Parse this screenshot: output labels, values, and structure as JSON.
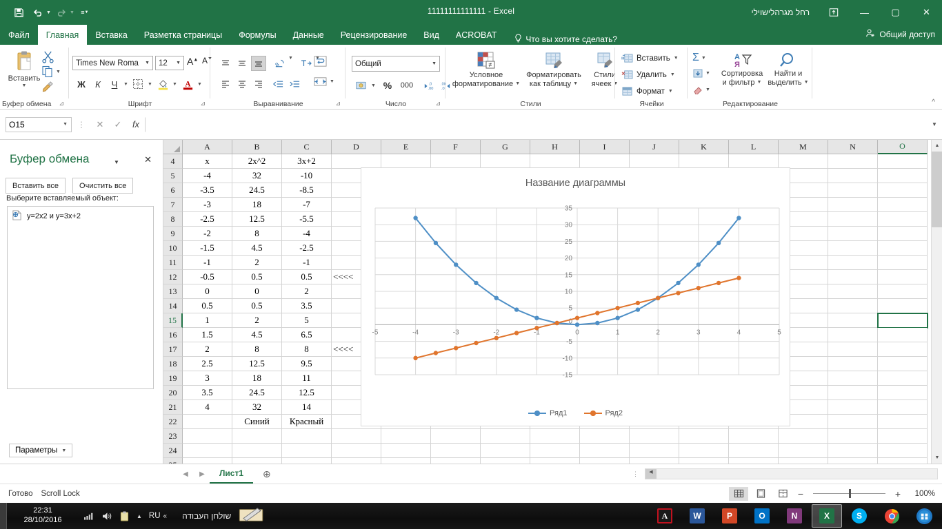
{
  "titlebar": {
    "document_title": "11111111111111  -  Excel",
    "user_name": "רחל מגרהלישוילי",
    "qat": [
      {
        "name": "save",
        "label": "Сохранить"
      },
      {
        "name": "undo",
        "label": "Отменить"
      },
      {
        "name": "redo",
        "label": "Вернуть"
      },
      {
        "name": "customize",
        "label": "Настройка панели быстрого доступа"
      }
    ],
    "window_buttons": [
      {
        "name": "ribbon-display-options",
        "glyph": "⤓"
      },
      {
        "name": "minimize",
        "glyph": "–"
      },
      {
        "name": "maximize",
        "glyph": "☐"
      },
      {
        "name": "close",
        "glyph": "✕"
      }
    ]
  },
  "ribbon": {
    "tabs": [
      {
        "label": "Файл",
        "active": false
      },
      {
        "label": "Главная",
        "active": true
      },
      {
        "label": "Вставка",
        "active": false
      },
      {
        "label": "Разметка страницы",
        "active": false
      },
      {
        "label": "Формулы",
        "active": false
      },
      {
        "label": "Данные",
        "active": false
      },
      {
        "label": "Рецензирование",
        "active": false
      },
      {
        "label": "Вид",
        "active": false
      },
      {
        "label": "ACROBAT",
        "active": false
      }
    ],
    "tell_me": "Что вы хотите сделать?",
    "share": "Общий доступ",
    "groups": {
      "clipboard": {
        "label": "Буфер обмена",
        "paste": "Вставить",
        "cut": "Вырезать",
        "copy": "Копировать",
        "format_painter": "Формат по образцу"
      },
      "font": {
        "label": "Шрифт",
        "font_name": "Times New Roma",
        "font_size": "12",
        "bold": "Ж",
        "italic": "К",
        "underline": "Ч",
        "grow_font": "A",
        "shrink_font": "A",
        "borders": "Границы",
        "fill_color": "Цвет заливки",
        "font_color": "A"
      },
      "alignment": {
        "label": "Выравнивание",
        "wrap_text": "Перенос текста",
        "merge_center": "Объединить и поместить в центре",
        "orientation": "Ориентация",
        "text_direction": "Направление текста"
      },
      "number": {
        "label": "Число",
        "format": "Общий",
        "percent": "%",
        "comma": "000",
        "increase_decimal": "Увеличить разрядность",
        "decrease_decimal": "Уменьшить разрядность"
      },
      "styles": {
        "label": "Стили",
        "conditional": "Условное\nформатирование",
        "conditional_l1": "Условное",
        "conditional_l2": "форматирование",
        "as_table_l1": "Форматировать",
        "as_table_l2": "как таблицу",
        "cell_styles_l1": "Стили",
        "cell_styles_l2": "ячеек"
      },
      "cells": {
        "label": "Ячейки",
        "insert": "Вставить",
        "delete": "Удалить",
        "format": "Формат"
      },
      "editing": {
        "label": "Редактирование",
        "autosum": "Σ",
        "fill": "Заполнить",
        "clear": "Очистить",
        "sort_filter_l1": "Сортировка",
        "sort_filter_l2": "и фильтр",
        "find_select_l1": "Найти и",
        "find_select_l2": "выделить"
      }
    }
  },
  "formula_bar": {
    "name_box": "O15",
    "cancel": "✕",
    "enter": "✓",
    "function": "fx",
    "value": ""
  },
  "clipboard_pane": {
    "title": "Буфер обмена",
    "paste_all": "Вставить все",
    "clear_all": "Очистить все",
    "hint": "Выберите вставляемый объект:",
    "items": [
      {
        "label": "y=2x2 и y=3x+2"
      }
    ],
    "options": "Параметры"
  },
  "grid": {
    "columns": [
      "A",
      "B",
      "C",
      "D",
      "E",
      "F",
      "G",
      "H",
      "I",
      "J",
      "K",
      "L",
      "M",
      "N",
      "O"
    ],
    "selected_column": "O",
    "selected_row": "15",
    "selected_cell": "O15",
    "rows": [
      {
        "n": "4",
        "A": "x",
        "B": "2x^2",
        "C": "3x+2",
        "D": ""
      },
      {
        "n": "5",
        "A": "-4",
        "B": "32",
        "C": "-10",
        "D": ""
      },
      {
        "n": "6",
        "A": "-3.5",
        "B": "24.5",
        "C": "-8.5",
        "D": ""
      },
      {
        "n": "7",
        "A": "-3",
        "B": "18",
        "C": "-7",
        "D": ""
      },
      {
        "n": "8",
        "A": "-2.5",
        "B": "12.5",
        "C": "-5.5",
        "D": ""
      },
      {
        "n": "9",
        "A": "-2",
        "B": "8",
        "C": "-4",
        "D": ""
      },
      {
        "n": "10",
        "A": "-1.5",
        "B": "4.5",
        "C": "-2.5",
        "D": ""
      },
      {
        "n": "11",
        "A": "-1",
        "B": "2",
        "C": "-1",
        "D": ""
      },
      {
        "n": "12",
        "A": "-0.5",
        "B": "0.5",
        "C": "0.5",
        "D": "<<<<"
      },
      {
        "n": "13",
        "A": "0",
        "B": "0",
        "C": "2",
        "D": ""
      },
      {
        "n": "14",
        "A": "0.5",
        "B": "0.5",
        "C": "3.5",
        "D": ""
      },
      {
        "n": "15",
        "A": "1",
        "B": "2",
        "C": "5",
        "D": ""
      },
      {
        "n": "16",
        "A": "1.5",
        "B": "4.5",
        "C": "6.5",
        "D": ""
      },
      {
        "n": "17",
        "A": "2",
        "B": "8",
        "C": "8",
        "D": "<<<<"
      },
      {
        "n": "18",
        "A": "2.5",
        "B": "12.5",
        "C": "9.5",
        "D": ""
      },
      {
        "n": "19",
        "A": "3",
        "B": "18",
        "C": "11",
        "D": ""
      },
      {
        "n": "20",
        "A": "3.5",
        "B": "24.5",
        "C": "12.5",
        "D": ""
      },
      {
        "n": "21",
        "A": "4",
        "B": "32",
        "C": "14",
        "D": ""
      },
      {
        "n": "22",
        "A": "",
        "B": "Синий",
        "C": "Красный",
        "D": ""
      },
      {
        "n": "23",
        "A": "",
        "B": "",
        "C": "",
        "D": ""
      },
      {
        "n": "24",
        "A": "",
        "B": "",
        "C": "",
        "D": ""
      }
    ]
  },
  "chart_data": {
    "type": "line",
    "title": "Название диаграммы",
    "xlabel": "",
    "ylabel": "",
    "xlim": [
      -5,
      5
    ],
    "ylim": [
      -15,
      35
    ],
    "x_ticks": [
      -5,
      -4,
      -3,
      -2,
      -1,
      0,
      1,
      2,
      3,
      4,
      5
    ],
    "y_ticks": [
      -15,
      -10,
      -5,
      0,
      5,
      10,
      15,
      20,
      25,
      30,
      35
    ],
    "grid": true,
    "legend_position": "bottom",
    "x": [
      -4,
      -3.5,
      -3,
      -2.5,
      -2,
      -1.5,
      -1,
      -0.5,
      0,
      0.5,
      1,
      1.5,
      2,
      2.5,
      3,
      3.5,
      4
    ],
    "series": [
      {
        "name": "Ряд1",
        "color": "#4e8fc6",
        "values": [
          32,
          24.5,
          18,
          12.5,
          8,
          4.5,
          2,
          0.5,
          0,
          0.5,
          2,
          4.5,
          8,
          12.5,
          18,
          24.5,
          32
        ]
      },
      {
        "name": "Ряд2",
        "color": "#e0752d",
        "values": [
          -10,
          -8.5,
          -7,
          -5.5,
          -4,
          -2.5,
          -1,
          0.5,
          2,
          3.5,
          5,
          6.5,
          8,
          9.5,
          11,
          12.5,
          14
        ]
      }
    ]
  },
  "sheet_bar": {
    "prev": "◀",
    "next": "▶",
    "tabs": [
      {
        "label": "Лист1",
        "active": true
      }
    ],
    "add": "⊕"
  },
  "status_bar": {
    "mode": "Готово",
    "scroll_lock": "Scroll Lock",
    "views": [
      {
        "name": "normal-view",
        "active": true
      },
      {
        "name": "page-layout-view",
        "active": false
      },
      {
        "name": "page-break-view",
        "active": false
      }
    ],
    "zoom_out": "−",
    "zoom_in": "+",
    "zoom_level": "100%"
  },
  "taskbar": {
    "time": "22:31",
    "date": "28/10/2016",
    "language": "RU",
    "desktop_label": "שולחן העבודה",
    "tray": [
      "network-icon",
      "volume-icon",
      "clipboard-icon",
      "show-hidden-icons"
    ],
    "apps": [
      {
        "name": "adobe-acrobat",
        "letter": "A",
        "bg": "#b0231e",
        "active": false
      },
      {
        "name": "microsoft-word",
        "letter": "W",
        "bg": "#2b579a",
        "active": false
      },
      {
        "name": "microsoft-powerpoint",
        "letter": "P",
        "bg": "#d24726",
        "active": false
      },
      {
        "name": "microsoft-outlook",
        "letter": "O",
        "bg": "#0072c6",
        "active": false
      },
      {
        "name": "microsoft-onenote",
        "letter": "N",
        "bg": "#80397b",
        "active": false
      },
      {
        "name": "microsoft-excel",
        "letter": "X",
        "bg": "#217346",
        "active": true
      },
      {
        "name": "skype",
        "letter": "S",
        "bg": "#00aff0",
        "active": false
      },
      {
        "name": "google-chrome",
        "letter": "",
        "bg": "#4285f4",
        "active": false
      },
      {
        "name": "start-orb",
        "letter": "",
        "bg": "#1f77c4",
        "active": false
      }
    ]
  }
}
